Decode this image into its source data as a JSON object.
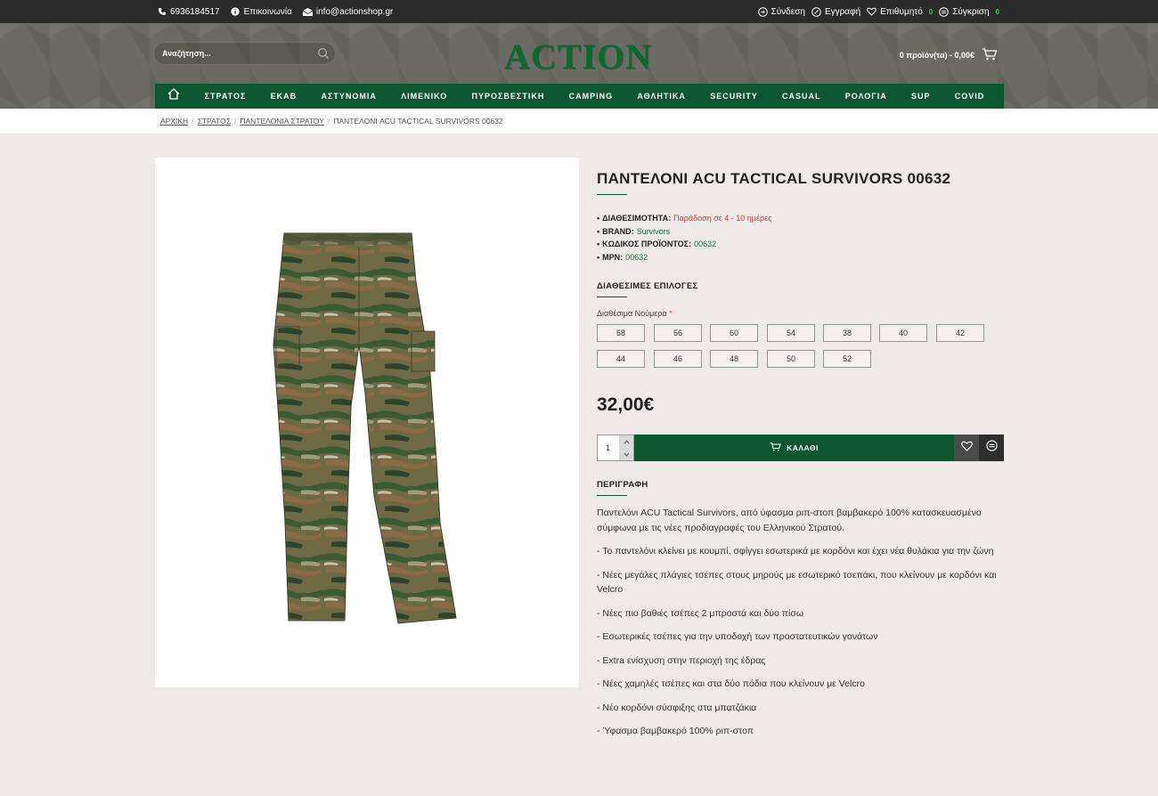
{
  "topbar": {
    "phone": "6936184517",
    "contact": "Επικοινωνία",
    "email": "info@actionshop.gr",
    "login": "Σύνδεση",
    "register": "Εγγραφή",
    "wishlist": "Επιθυμητό",
    "wishlist_count": "0",
    "compare": "Σύγκριση",
    "compare_count": "0"
  },
  "header": {
    "search_placeholder": "Αναζήτηση...",
    "logo": "ACTION",
    "cart": "0 προϊόν(τα) - 0,00€"
  },
  "nav": [
    "ΣΤΡΑΤΟΣ",
    "ΕΚΑΒ",
    "ΑΣΤΥΝΟΜΙΑ",
    "ΛΙΜΕΝΙΚΟ",
    "ΠΥΡΟΣΒΕΣΤΙΚΗ",
    "CAMPING",
    "ΑΘΛΗΤΙΚΑ",
    "SECURITY",
    "CASUAL",
    "ΡΟΛΟΓΙΑ",
    "SUP",
    "COVID"
  ],
  "breadcrumb": {
    "home": "ΑΡΧΙΚΗ",
    "c1": "ΣΤΡΑΤΟΣ",
    "c2": "ΠΑΝΤΕΛΟΝΙΑ ΣΤΡΑΤΟΥ",
    "current": "ΠΑΝΤΕΛΟΝΙ ACU TACTICAL SURVIVORS 00632"
  },
  "product": {
    "title": "ΠΑΝΤΕΛΟΝΙ ACU TACTICAL SURVIVORS 00632",
    "availability_label": "ΔΙΑΘΕΣΙΜΟΤΗΤΑ:",
    "availability": "Παράδοση σε 4 - 10 ημέρες",
    "brand_label": "BRAND:",
    "brand": "Survivors",
    "code_label": "ΚΩΔΙΚΟΣ ΠΡΟΪΟΝΤΟΣ:",
    "code": "00632",
    "mpn_label": "MPN:",
    "mpn": "00632",
    "options_heading": "ΔΙΑΘΕΣΙΜΕΣ ΕΠΙΛΟΓΕΣ",
    "sizes_label": "Διαθέσιμα Νούμερα",
    "sizes": [
      "58",
      "56",
      "60",
      "54",
      "38",
      "40",
      "42",
      "44",
      "46",
      "48",
      "50",
      "52"
    ],
    "price": "32,00€",
    "quantity": "1",
    "add_to_cart": "ΚΑΛΑΘΙ",
    "description_heading": "ΠΕΡΙΓΡΑΦΗ",
    "description": [
      "Παντελόνι ACU Tactical Survivors, από ύφασμα ριπ-στοπ βαμβακερό 100% κατασκευασμένο σύμφωνα με τις νέες προδιαγραφές του Ελληνικού Στρατού.",
      "- Το παντελόνι κλείνει με κουμπί, σφίγγει εσωτερικά με κορδόνι και έχει νέα θυλάκια για την ζώνη",
      "- Νέες μεγάλες πλάγιες τσέπες στους μηρούς με εσωτερικό τσεπάκι, που κλείνουν με κορδόνι και Velcro",
      "- Νέες πιο βαθιές τσέπες 2 μπροστά και δύο πίσω",
      "- Εσωτερικές τσέπες για την υποδοχή των προστατευτικών γονάτων",
      "- Extra ενίσχυση στην περιοχή της έδρας",
      "- Νέες χαμηλές τσέπες και στα δύο πόδια που κλείνουν με Velcro",
      "- Νέο κορδόνι σύσφιξης στα μπατζάκια",
      "- Ύφασμα βαμβακερό 100% ριπ-στοπ"
    ]
  },
  "colors": {
    "brand_green": "#0d5730",
    "topbar": "#2b2b2b",
    "availability": "#dd3333"
  }
}
